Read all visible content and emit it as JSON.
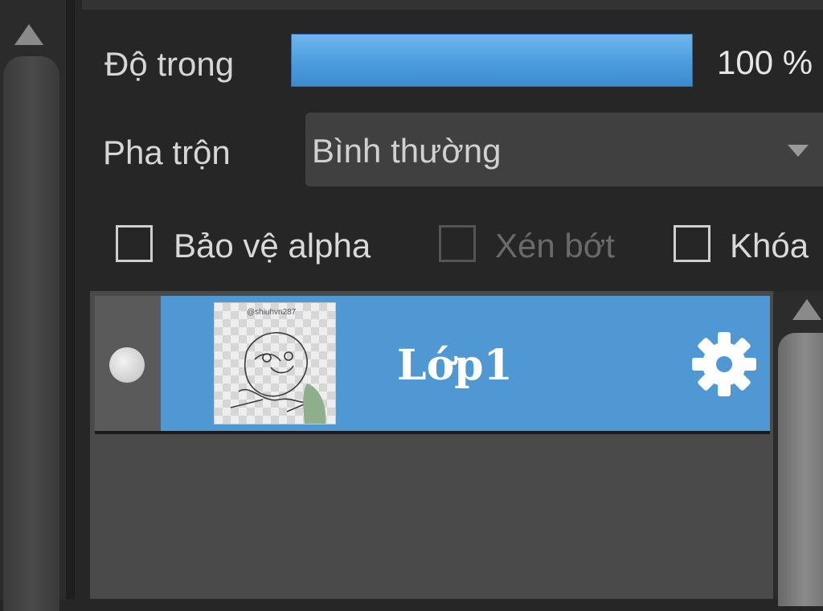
{
  "layer_panel": {
    "opacity": {
      "label": "Độ trong",
      "value_text": "100 %",
      "value": 100
    },
    "blend": {
      "label": "Pha trộn",
      "selected": "Bình thường"
    },
    "checkboxes": [
      {
        "label": "Bảo vệ alpha",
        "checked": false,
        "enabled": true
      },
      {
        "label": "Xén bớt",
        "checked": false,
        "enabled": false
      },
      {
        "label": "Khóa",
        "checked": false,
        "enabled": true
      }
    ],
    "layers": [
      {
        "name": "Lớp1",
        "thumbnail_caption": "@shiuhvn287",
        "visible": true,
        "selected": true
      }
    ]
  },
  "colors": {
    "accent": "#4f98d3",
    "panel_bg": "#262626",
    "list_bg": "#4a4a4a"
  },
  "icons": {
    "visibility": "visibility-dot-icon",
    "settings": "gear-icon",
    "scroll_up": "scroll-up-arrow-icon",
    "dropdown": "chevron-down-icon"
  }
}
